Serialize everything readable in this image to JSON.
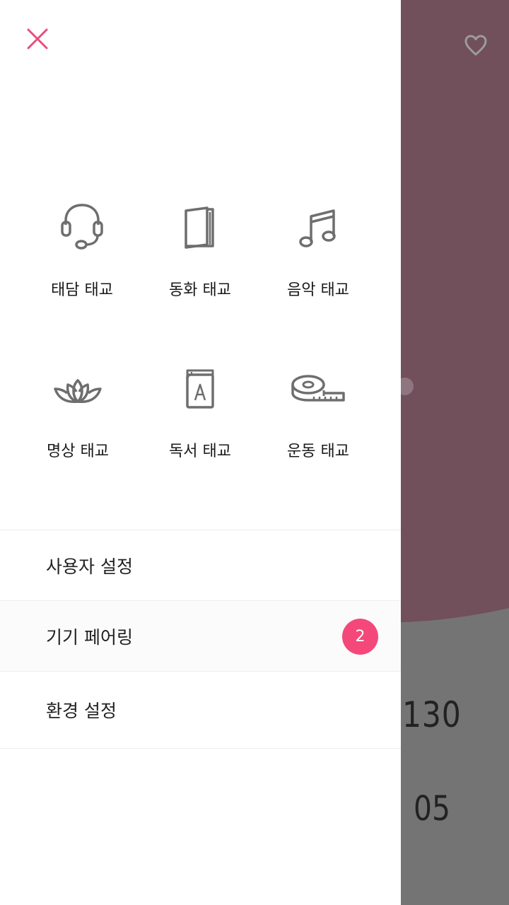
{
  "background_screen": {
    "value_primary": "130",
    "value_secondary": "05",
    "accent_color": "#714f5b",
    "icons": [
      "heart-outline-icon"
    ]
  },
  "drawer": {
    "close_icon": "close-icon",
    "close_color": "#e94e7b",
    "categories": [
      {
        "label": "태담 태교",
        "icon": "headset-icon"
      },
      {
        "label": "동화 태교",
        "icon": "book-icon"
      },
      {
        "label": "음악 태교",
        "icon": "music-note-icon"
      },
      {
        "label": "명상 태교",
        "icon": "lotus-icon"
      },
      {
        "label": "독서 태교",
        "icon": "alphabet-book-icon"
      },
      {
        "label": "운동 태교",
        "icon": "tape-measure-icon"
      }
    ],
    "menu": [
      {
        "label": "사용자 설정"
      },
      {
        "label": "기기 페어링",
        "badge": "2"
      },
      {
        "label": "환경 설정"
      }
    ],
    "badge_color": "#f5487a"
  }
}
